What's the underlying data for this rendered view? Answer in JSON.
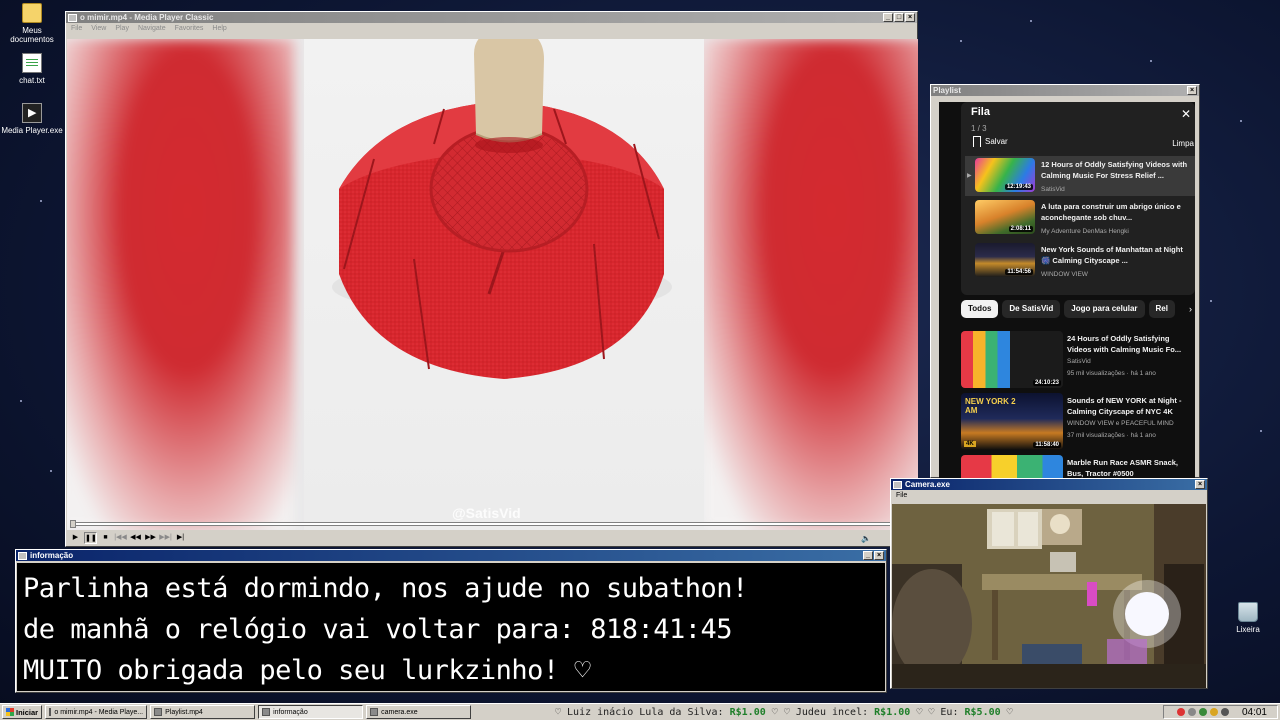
{
  "desktop": {
    "icons": [
      {
        "label": "Meus documentos",
        "icon": "folder-icon"
      },
      {
        "label": "chat.txt",
        "icon": "text-file-icon"
      },
      {
        "label": "Media Player.exe",
        "icon": "media-player-icon"
      },
      {
        "label": "Lixeira",
        "icon": "recycle-bin-icon"
      }
    ]
  },
  "media_player": {
    "title": "o mimir.mp4 - Media Player Classic",
    "menu": [
      "File",
      "View",
      "Play",
      "Navigate",
      "Favorites",
      "Help"
    ],
    "watermark": "@SatisVid",
    "progress": 0.0
  },
  "playlist_window": {
    "title": "Playlist",
    "queue_title": "Fila",
    "queue_count": "1 / 3",
    "save_label": "Salvar",
    "clear_label": "Limpa",
    "queue": [
      {
        "title": "12 Hours of Oddly Satisfying Videos with Calming Music For Stress Relief ...",
        "channel": "SatisVid",
        "duration": "12:19:43",
        "playing": true
      },
      {
        "title": "A luta para construir um abrigo único e aconchegante sob chuv...",
        "channel": "My Adventure DenMas Hengki",
        "duration": "2:08:11",
        "playing": false
      },
      {
        "title": "New York Sounds of Manhattan at Night 🎆 Calming Cityscape ...",
        "channel": "WINDOW VIEW",
        "duration": "11:54:56",
        "playing": false
      }
    ],
    "chips": [
      "Todos",
      "De SatisVid",
      "Jogo para celular",
      "Rel"
    ],
    "related": [
      {
        "title": "24 Hours of Oddly Satisfying Videos with Calming Music Fo...",
        "channel": "SatisVid",
        "meta": "95 mil visualizações · há 1 ano",
        "duration": "24:10:23",
        "thumb_text": ""
      },
      {
        "title": "Sounds of NEW YORK at Night - Calming Cityscape of NYC 4K",
        "channel": "WINDOW VIEW e PEACEFUL MIND",
        "meta": "37 mil visualizações · há 1 ano",
        "duration": "11:58:40",
        "thumb_text": "NEW YORK 2 AM",
        "badge": "4K"
      },
      {
        "title": "Marble Run Race ASMR Snack, Bus, Tractor #0500",
        "channel": "",
        "meta": "",
        "duration": "",
        "thumb_text": ""
      }
    ]
  },
  "camera": {
    "title": "Camera.exe",
    "menu": [
      "File"
    ]
  },
  "info": {
    "title": "informação",
    "lines": [
      "Parlinha está dormindo, nos ajude no subathon!",
      "de manhã o relógio vai voltar para:  818:41:45",
      "MUITO obrigada pelo seu lurkzinho! ♡"
    ]
  },
  "taskbar": {
    "start_label": "Iniciar",
    "tasks": [
      {
        "label": "o mimir.mp4 - Media Playe...",
        "active": false
      },
      {
        "label": "Playlist.mp4",
        "active": false
      },
      {
        "label": "informação",
        "active": true
      },
      {
        "label": "camera.exe",
        "active": false
      }
    ],
    "ticker": [
      {
        "name": "♡ Luiz inácio Lula da Silva:",
        "amount": "R$1.00",
        "suffix": " ♡"
      },
      {
        "name": "   ♡ Judeu incel:",
        "amount": "R$1.00",
        "suffix": " ♡"
      },
      {
        "name": "   ♡ Eu:",
        "amount": "R$5.00",
        "suffix": " ♡"
      }
    ],
    "clock": "04:01"
  },
  "colors": {
    "title_active": "#0a246a",
    "taskbar_bg": "#d4d0c8",
    "donation_green": "#1f7f2a",
    "clay_red": "#d7262d"
  }
}
